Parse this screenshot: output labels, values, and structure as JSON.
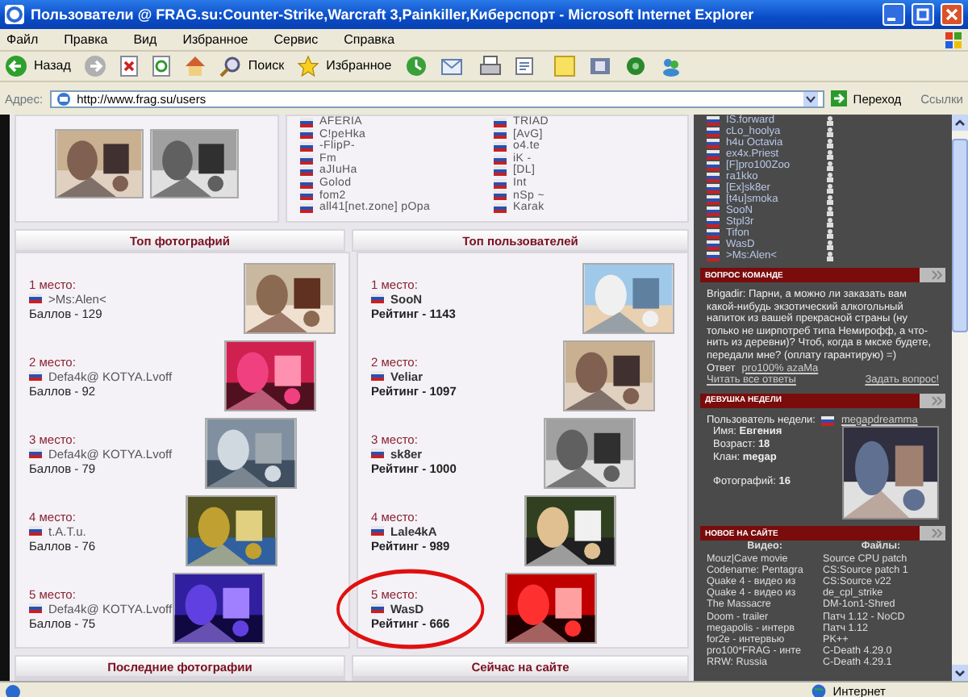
{
  "window": {
    "title": "Пользователи @ FRAG.su:Counter-Strike,Warcraft 3,Painkiller,Киберспорт - Microsoft Internet Explorer"
  },
  "menu": [
    "Файл",
    "Правка",
    "Вид",
    "Избранное",
    "Сервис",
    "Справка"
  ],
  "toolbar": {
    "back": "Назад",
    "search": "Поиск",
    "favorites": "Избранное"
  },
  "address": {
    "label": "Адрес:",
    "url": "http://www.frag.su/users",
    "go": "Переход",
    "links": "Ссылки"
  },
  "clans": {
    "column_1": [
      "AFERIA",
      "C!peHka",
      "-FlipP-",
      "Fm",
      "aJIuHa",
      "Golod",
      "fom2",
      "all41[net.zone] pOpa"
    ],
    "column_2": [
      "TRIAD",
      "[AvG]",
      "o4.te",
      "iK -",
      "[DL]",
      "Int",
      "nSp ~",
      "Karak"
    ]
  },
  "top_photos": {
    "title": "Топ фотографий",
    "entries": [
      {
        "place": "1 место:",
        "name": ">Ms:Alen<",
        "score": "Баллов - 129"
      },
      {
        "place": "2 место:",
        "name": "Defa4k@ KOTYA.Lvoff",
        "score": "Баллов - 92"
      },
      {
        "place": "3 место:",
        "name": "Defa4k@ KOTYA.Lvoff",
        "score": "Баллов - 79"
      },
      {
        "place": "4 место:",
        "name": "t.A.T.u.",
        "score": "Баллов - 76"
      },
      {
        "place": "5 место:",
        "name": "Defa4k@ KOTYA.Lvoff",
        "score": "Баллов - 75"
      }
    ]
  },
  "top_users": {
    "title": "Топ пользователей",
    "entries": [
      {
        "place": "1 место:",
        "name": "SooN",
        "score": "Рейтинг - 1143",
        "circled": false
      },
      {
        "place": "2 место:",
        "name": "Veliar",
        "score": "Рейтинг - 1097",
        "circled": false
      },
      {
        "place": "3 место:",
        "name": "sk8er",
        "score": "Рейтинг - 1000",
        "circled": false
      },
      {
        "place": "4 место:",
        "name": "Lale4kA",
        "score": "Рейтинг - 989",
        "circled": false
      },
      {
        "place": "5 место:",
        "name": "WasD",
        "score": "Рейтинг - 666",
        "circled": true
      }
    ]
  },
  "footer_headers": [
    "Последние фотографии",
    "Сейчас на сайте"
  ],
  "online": [
    "IS.forward",
    "cLo_hoolya",
    "h4u Octavia",
    "ex4x.Priest",
    "[F]pro100Zoo",
    "ra1kko",
    "[Ex]sk8er",
    "[t4u]smoka",
    "SooN",
    "Stpl3r",
    "Tifon",
    "WasD",
    ">Ms:Alen<"
  ],
  "question": {
    "title": "ВОПРОС КОМАНДЕ",
    "author": "Brigadir:",
    "text": "Парни, а можно ли заказать вам какой-нибудь экзотический алкогольный напиток из вашей прекрасной страны (ну только не ширпотреб типа Немирофф, а что-нить из деревни)? Чтоб, когда в мкске будете, передали мне? (оплату гарантирую) =)",
    "answer_label": "Ответ",
    "answer_user": "pro100% azaMa",
    "read_all": "Читать все ответы",
    "ask": "Задать вопрос!"
  },
  "user_of_week": {
    "title": "ДЕВУШКА НЕДЕЛИ",
    "label": "Пользователь недели:",
    "user": "megapdreamma",
    "fields": [
      {
        "label": "Имя:",
        "value": "Евгения"
      },
      {
        "label": "Возраст:",
        "value": "18"
      },
      {
        "label": "Клан:",
        "value": "megap"
      },
      {
        "label": "Фотографий:",
        "value": "16"
      }
    ]
  },
  "new": {
    "title": "НОВОЕ НА САЙТЕ",
    "columns": [
      {
        "heading": "Видео:",
        "items": [
          "Mouz|Cave movie",
          "Codename: Pentagra",
          "Quake 4 - видео из",
          "Quake 4 - видео из",
          "The Massacre",
          "Doom - trailer",
          "megapolis - интерв",
          "for2e - интервью",
          "pro100*FRAG - инте",
          "RRW: Russia"
        ]
      },
      {
        "heading": "Файлы:",
        "items": [
          "Source CPU patch",
          "CS:Source patch 1",
          "CS:Source v22",
          "de_cpl_strike",
          "DM-1on1-Shred",
          "Патч 1.12 - NoCD",
          "Патч 1.12",
          "PK++",
          "C-Death 4.29.0",
          "C-Death 4.29.1"
        ]
      }
    ]
  },
  "status_bar": {
    "zone": "Интернет"
  }
}
